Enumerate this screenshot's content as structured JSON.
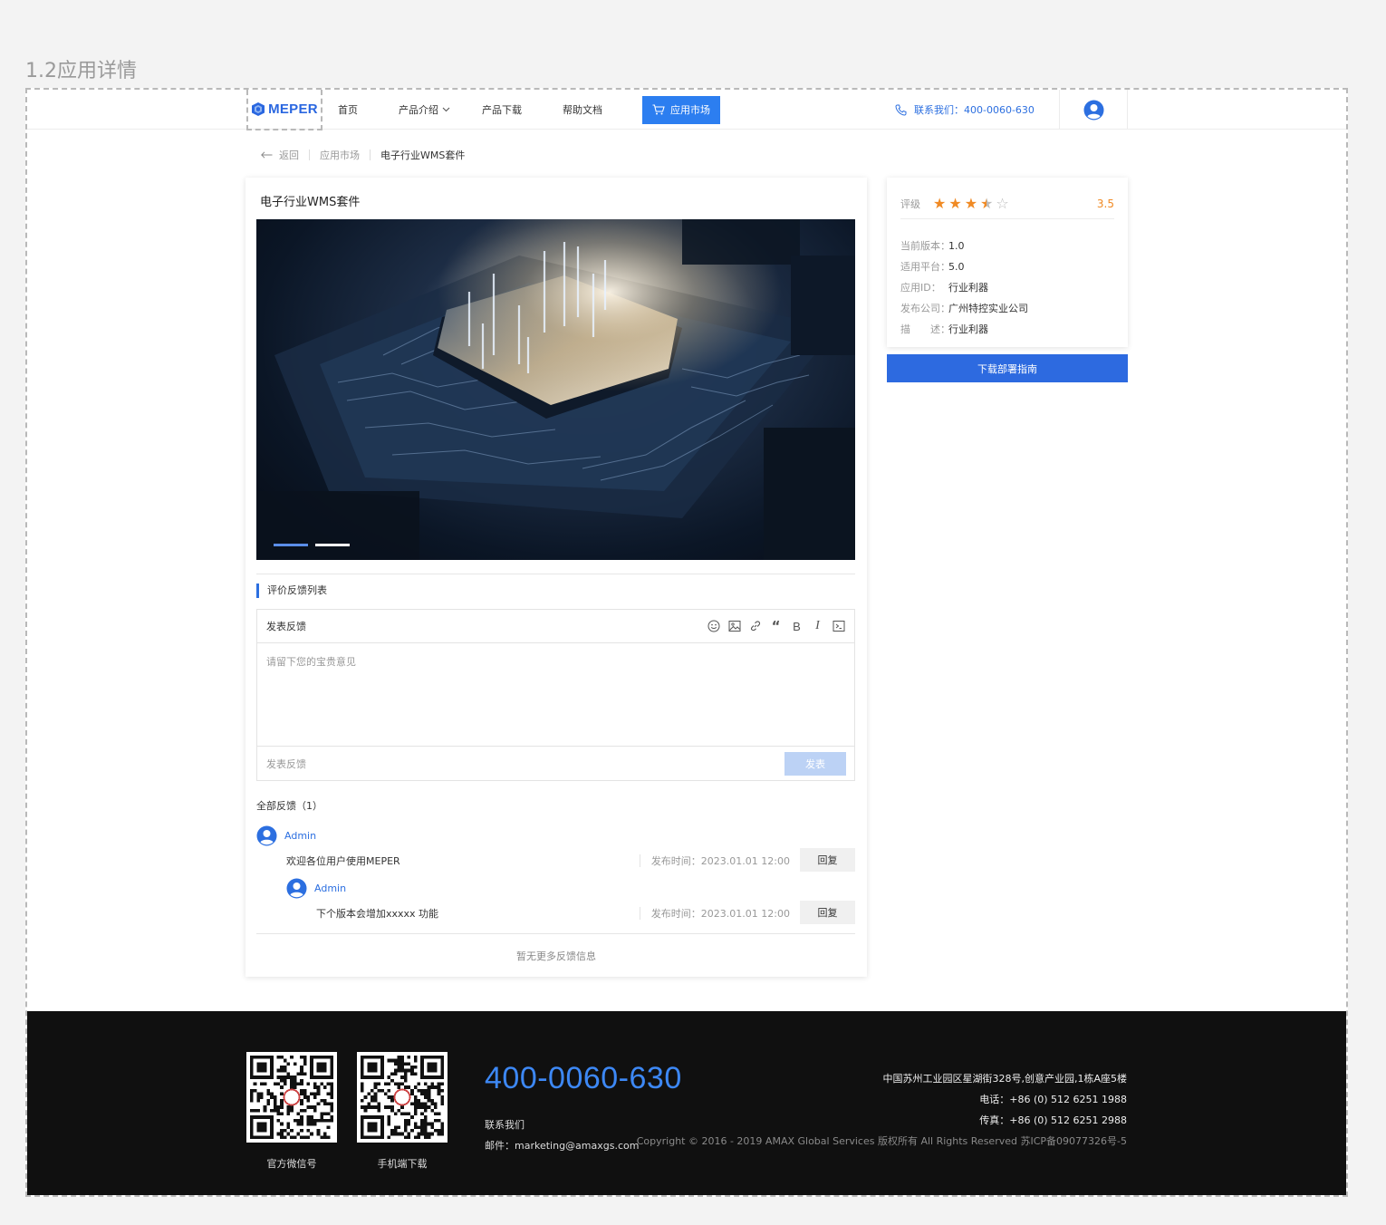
{
  "frame_title": "1.2应用详情",
  "header": {
    "logo": "MEPER",
    "nav": [
      "首页",
      "产品介绍",
      "产品下载",
      "帮助文档"
    ],
    "market_label": "应用市场",
    "contact": "联系我们：400-0060-630"
  },
  "breadcrumb": {
    "back": "返回",
    "parent": "应用市场",
    "current": "电子行业WMS套件"
  },
  "app": {
    "title": "电子行业WMS套件",
    "carousel": {
      "slides": 2,
      "active": 1
    }
  },
  "feedback": {
    "section_title": "评价反馈列表",
    "editor_title": "发表反馈",
    "toolbar_icons": [
      "emoji-icon",
      "image-icon",
      "link-icon",
      "quote-icon",
      "bold-icon",
      "italic-icon",
      "code-icon"
    ],
    "placeholder": "请留下您的宝贵意见",
    "footer_label": "发表反馈",
    "submit": "发表",
    "all_count": "全部反馈（1）",
    "items": [
      {
        "user": "Admin",
        "text": "欢迎各位用户使用MEPER",
        "time": "发布时间：2023.01.01 12:00",
        "reply": "回复"
      },
      {
        "user": "Admin",
        "text": "下个版本会增加xxxxx 功能",
        "time": "发布时间：2023.01.01 12:00",
        "reply": "回复"
      }
    ],
    "no_more": "暂无更多反馈信息"
  },
  "details": {
    "rating_label": "评级",
    "rating": 3.5,
    "score_text": "3.5",
    "rows": [
      {
        "label": "当前版本：",
        "value": "1.0"
      },
      {
        "label": "适用平台：",
        "value": "5.0"
      },
      {
        "label": "应用ID：",
        "value": "行业利器"
      },
      {
        "label": "发布公司：",
        "value": "广州特控实业公司"
      },
      {
        "label": "描　　述：",
        "value": "行业利器"
      }
    ],
    "download_button": "下载部署指南"
  },
  "footer": {
    "qr_labels": [
      "官方微信号",
      "手机端下载"
    ],
    "phone": "400-0060-630",
    "contact_label": "联系我们",
    "email": "邮件：marketing@amaxgs.com",
    "address": "中国苏州工业园区星湖街328号,创意产业园,1栋A座5楼",
    "tel": "电话：+86 (0) 512 6251 1988",
    "fax": "传真：+86 (0) 512 6251 2988",
    "copyright": "Copyright © 2016 - 2019 AMAX Global Services 版权所有 All Rights Reserved 苏ICP备09077326号-5"
  },
  "colors": {
    "accent": "#2c6fe0",
    "star": "#f08a24",
    "footer_bg": "#101010",
    "phone": "#3d88f5"
  }
}
